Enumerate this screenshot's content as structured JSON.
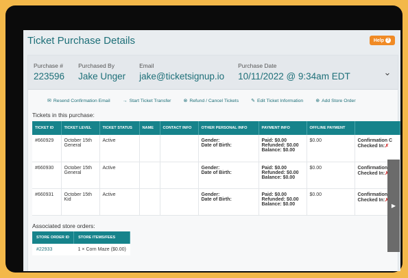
{
  "header": {
    "title": "Ticket Purchase Details",
    "help_label": "Help"
  },
  "summary": {
    "purchase_label": "Purchase #",
    "purchase_value": "223596",
    "purchased_by_label": "Purchased By",
    "purchased_by_value": "Jake Unger",
    "email_label": "Email",
    "email_value": "jake@ticketsignup.io",
    "date_label": "Purchase Date",
    "date_value": "10/11/2022 @ 9:34am EDT"
  },
  "actions": [
    {
      "label": "Resend Confirmation Email",
      "icon": "email-icon"
    },
    {
      "label": "Start Ticket Transfer",
      "icon": "arrow-right-icon"
    },
    {
      "label": "Refund / Cancel Tickets",
      "icon": "cancel-icon"
    },
    {
      "label": "Edit Ticket Information",
      "icon": "edit-icon"
    },
    {
      "label": "Add Store Order",
      "icon": "plus-icon"
    }
  ],
  "tickets_section": {
    "label": "Tickets in this purchase:",
    "headers": [
      "TICKET ID",
      "TICKET LEVEL",
      "TICKET STATUS",
      "NAME",
      "CONTACT INFO",
      "OTHER PERSONAL INFO",
      "PAYMENT INFO",
      "OFFLINE PAYMENT",
      ""
    ],
    "rows": [
      {
        "id": "#660929",
        "level": "October 15th General",
        "status": "Active",
        "gender": "Gender:",
        "dob": "Date of Birth:",
        "paid": "Paid: $0.00",
        "refunded": "Refunded: $0.00",
        "balance": "Balance: $0.00",
        "offline": "$0.00",
        "confirmation": "Confirmation C",
        "checked_in": "Checked In:"
      },
      {
        "id": "#660930",
        "level": "October 15th General",
        "status": "Active",
        "gender": "Gender:",
        "dob": "Date of Birth:",
        "paid": "Paid: $0.00",
        "refunded": "Refunded: $0.00",
        "balance": "Balance: $0.00",
        "offline": "$0.00",
        "confirmation": "Confirmation C",
        "checked_in": "Checked In:"
      },
      {
        "id": "#660931",
        "level": "October 15th Kid",
        "status": "Active",
        "gender": "Gender:",
        "dob": "Date of Birth:",
        "paid": "Paid: $0.00",
        "refunded": "Refunded: $0.00",
        "balance": "Balance: $0.00",
        "offline": "$0.00",
        "confirmation": "Confirmation C",
        "checked_in": "Checked In:"
      }
    ]
  },
  "store_section": {
    "label": "Associated store orders:",
    "headers": [
      "STORE ORDER ID",
      "STORE ITEMS/FEES"
    ],
    "rows": [
      {
        "id": "#22933",
        "items": "1 × Corn Maze ($0.00)"
      }
    ]
  },
  "colors": {
    "accent": "#16838b",
    "title": "#1d6f78",
    "help": "#f08a24",
    "frame": "#f3b84a"
  }
}
